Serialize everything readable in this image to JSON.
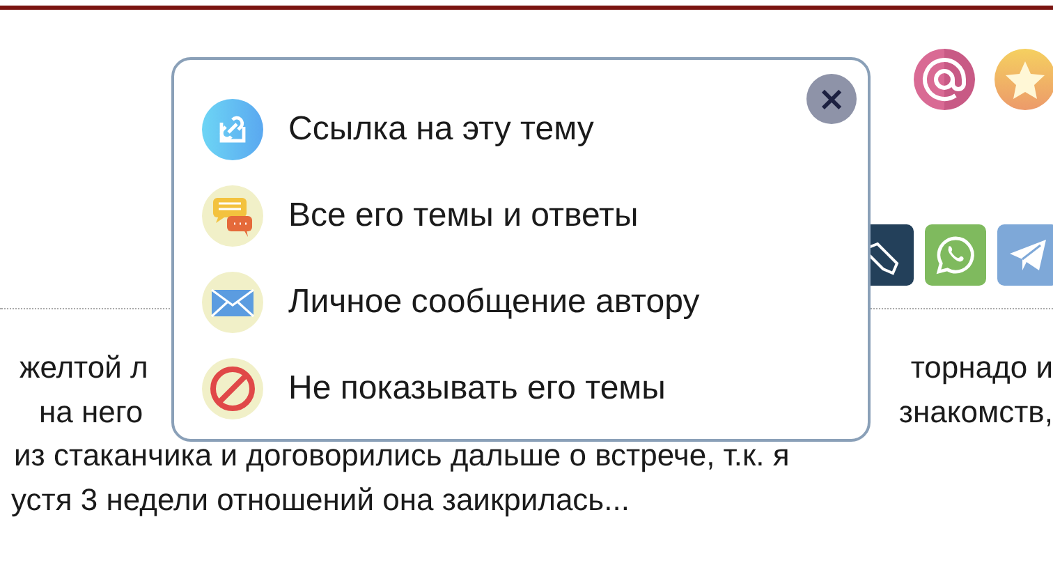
{
  "header": {
    "icons": [
      {
        "kind": "at"
      },
      {
        "kind": "star"
      }
    ]
  },
  "share_buttons": [
    {
      "kind": "pencil"
    },
    {
      "kind": "whatsapp"
    },
    {
      "kind": "telegram"
    }
  ],
  "post_text": [
    {
      "left": "желтой л",
      "right": "торнадо и"
    },
    {
      "left": "на него",
      "right": "знакомств,"
    },
    {
      "left": "из стаканчика и договорились дальше о встрече, т.к. я"
    },
    {
      "left": "устя 3 недели отношений она заикрилась..."
    }
  ],
  "popup": {
    "close": "×",
    "items": [
      {
        "kind": "link",
        "label": "Ссылка на эту тему"
      },
      {
        "kind": "topics",
        "label": "Все его темы и ответы"
      },
      {
        "kind": "message",
        "label": "Личное сообщение автору"
      },
      {
        "kind": "block",
        "label": "Не показывать его темы"
      }
    ]
  }
}
